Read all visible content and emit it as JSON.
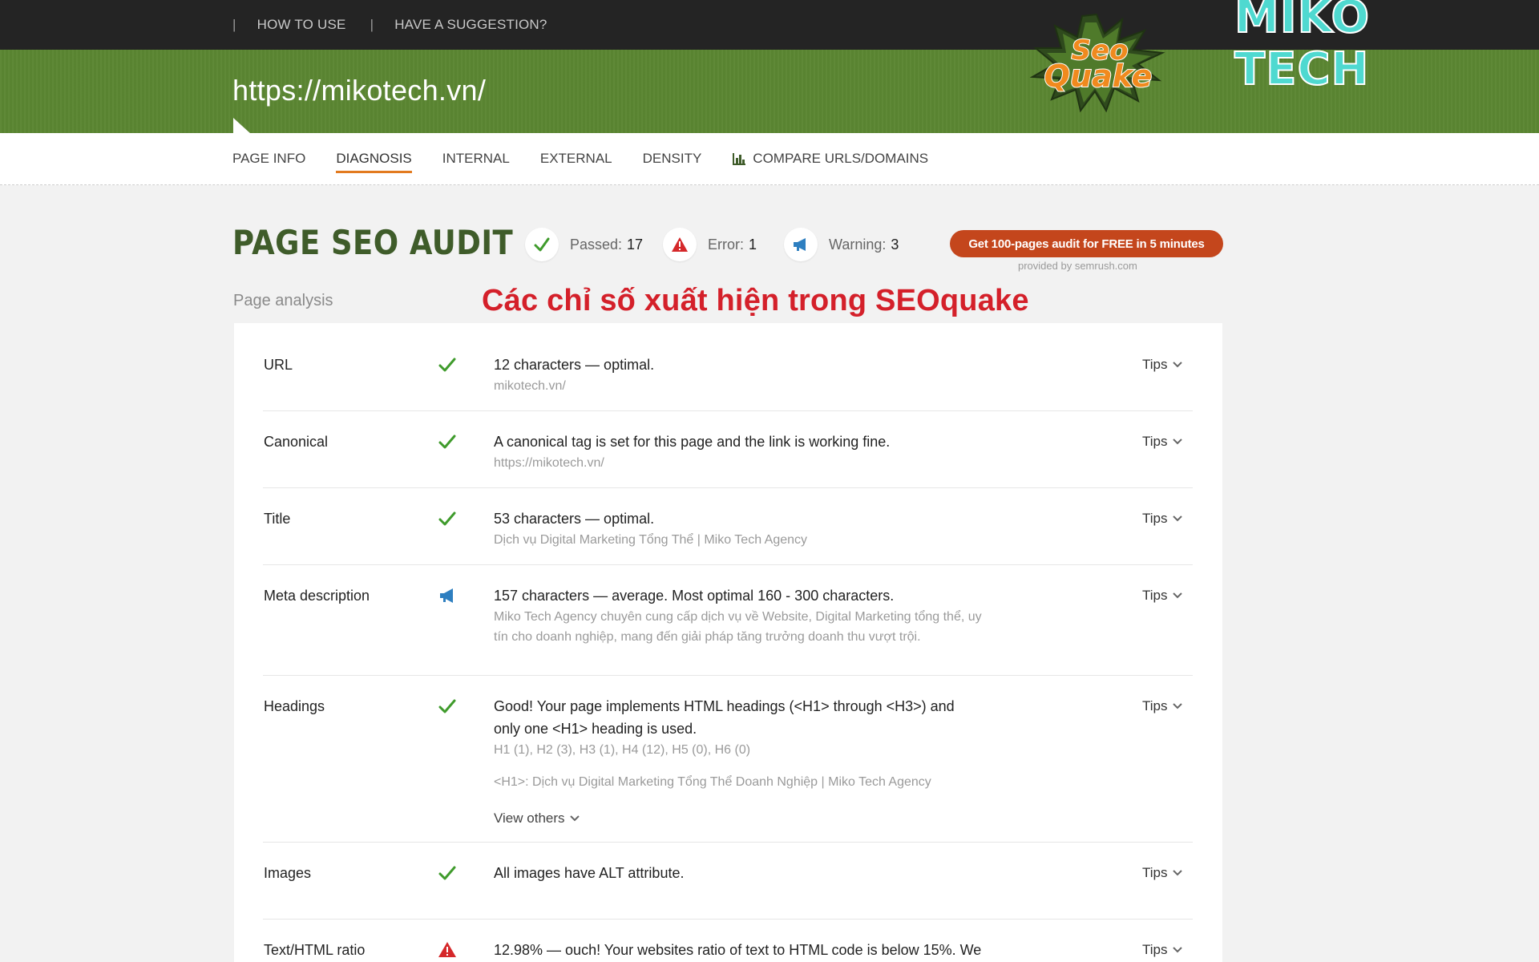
{
  "topnav": {
    "separator": "|",
    "how_to_use": "HOW TO USE",
    "suggestion": "HAVE A SUGGESTION?"
  },
  "header": {
    "url": "https://mikotech.vn/"
  },
  "logos": {
    "seoquake": {
      "line1": "Seo",
      "line2": "Quake"
    },
    "brand": "MIKO TECH"
  },
  "tabs": [
    {
      "label": "PAGE INFO"
    },
    {
      "label": "DIAGNOSIS",
      "active": true
    },
    {
      "label": "INTERNAL"
    },
    {
      "label": "EXTERNAL"
    },
    {
      "label": "DENSITY"
    },
    {
      "label": "COMPARE URLS/DOMAINS",
      "icon": "bar-chart-icon"
    }
  ],
  "audit": {
    "title": "PAGE SEO AUDIT",
    "passed_label": "Passed:",
    "passed_count": "17",
    "error_label": "Error:",
    "error_count": "1",
    "warning_label": "Warning:",
    "warning_count": "3",
    "cta": "Get 100-pages audit for FREE in 5 minutes",
    "provided_by": "provided by  semrush.com"
  },
  "section_label": "Page analysis",
  "annotation": "Các chỉ số xuất hiện trong SEOquake",
  "colors": {
    "pass": "#3f9b2c",
    "error": "#d5282a",
    "warning": "#2e7fc0",
    "accent": "#c4461c",
    "green_band": "#5b8632"
  },
  "rows": [
    {
      "label": "URL",
      "status": "check-icon",
      "text": "12 characters — optimal.",
      "sub": "mikotech.vn/",
      "tips": "Tips"
    },
    {
      "label": "Canonical",
      "status": "check-icon",
      "text": "A canonical tag is set for this page and the link is working fine.",
      "sub": "https://mikotech.vn/",
      "tips": "Tips"
    },
    {
      "label": "Title",
      "status": "check-icon",
      "text": "53 characters — optimal.",
      "sub": "Dịch vụ Digital Marketing Tổng Thể | Miko Tech Agency",
      "tips": "Tips"
    },
    {
      "label": "Meta description",
      "status": "megaphone-icon",
      "text": "157 characters — average. Most optimal 160 - 300 characters.",
      "sub": "Miko Tech Agency chuyên cung cấp dịch vụ về Website, Digital Marketing tổng thể, uy tín cho doanh nghiệp, mang đến giải pháp tăng trưởng doanh thu vượt trội.",
      "tips": "Tips"
    },
    {
      "label": "Headings",
      "status": "check-icon",
      "text": "Good! Your page implements HTML headings (<H1> through <H3>) and only one <H1> heading is used.",
      "sub": "H1 (1), H2 (3), H3 (1), H4 (12), H5 (0), H6 (0)",
      "sub2": "<H1>: Dịch vụ Digital Marketing Tổng Thể Doanh Nghiệp | Miko Tech Agency",
      "view_others": "View others",
      "tips": "Tips"
    },
    {
      "label": "Images",
      "status": "check-icon",
      "text": "All images have ALT attribute.",
      "tips": "Tips"
    },
    {
      "label": "Text/HTML ratio",
      "status": "warning-triangle-icon",
      "text": "12.98% — ouch! Your websites ratio of text to HTML code is below 15%. We",
      "tips": "Tips"
    }
  ]
}
